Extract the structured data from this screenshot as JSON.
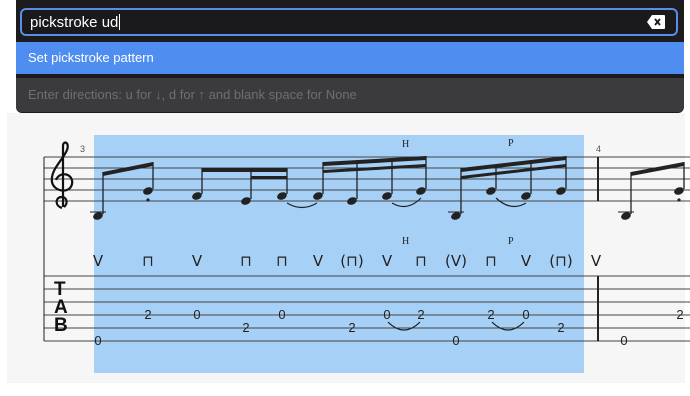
{
  "command_palette": {
    "query": "pickstroke ud",
    "suggestion": "Set pickstroke pattern",
    "hint": "Enter directions: u for ↓, d for ↑ and blank space for None"
  },
  "score": {
    "measure_numbers": [
      "3",
      "4"
    ],
    "clef": "treble-clef",
    "tab_label": [
      "T",
      "A",
      "B"
    ],
    "technique_marks_staff": [
      "H",
      "P"
    ],
    "technique_marks_strokes": [
      "H",
      "P"
    ],
    "pickstrokes": [
      "V",
      "⊓",
      "V",
      "⊓",
      "⊓",
      "V",
      "(⊓)",
      "V",
      "⊓",
      "(V)",
      "⊓",
      "V",
      "(⊓)",
      "V"
    ],
    "tab_numbers": [
      "0",
      "2",
      "0",
      "2",
      "0",
      "2",
      "0",
      "2",
      "0",
      "2",
      "0",
      "2",
      "0",
      "2"
    ],
    "selection_color": "#a7d0f7",
    "accent_color": "#4f8ef0"
  }
}
